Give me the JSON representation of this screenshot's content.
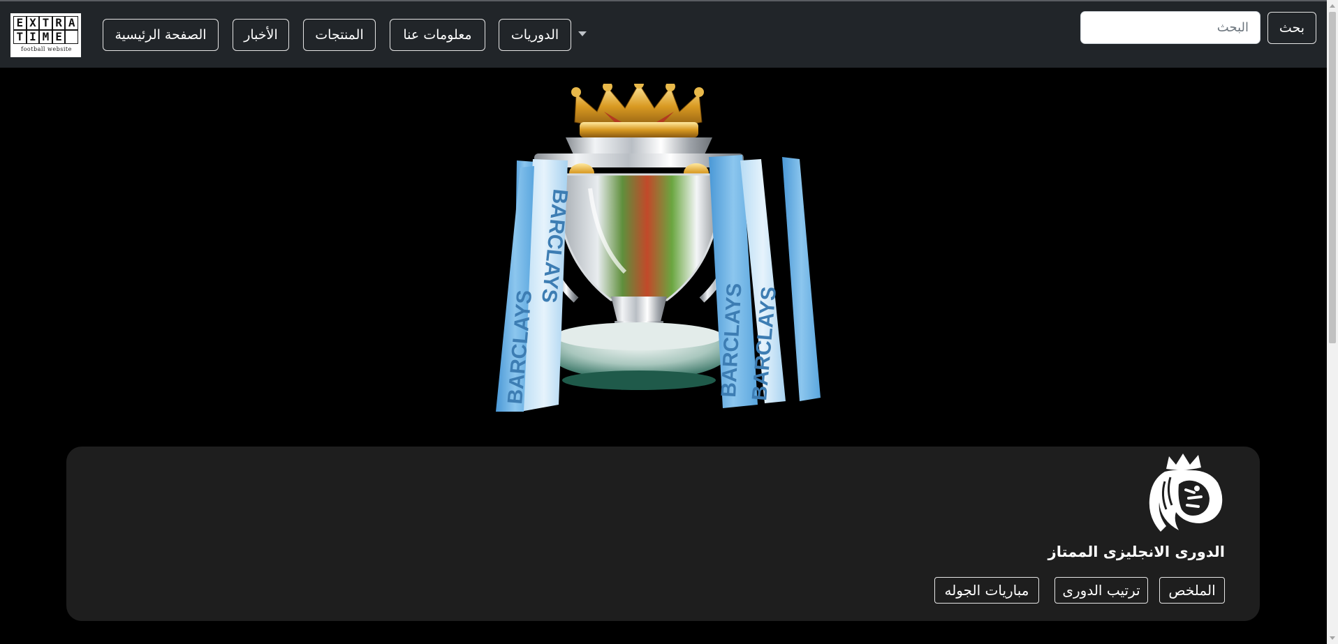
{
  "logo": {
    "letters_row1": [
      "E",
      "X",
      "T",
      "R",
      "A"
    ],
    "letters_row2": [
      "T",
      "I",
      "M",
      "E",
      ""
    ],
    "subtitle": "football website"
  },
  "nav": {
    "home": "الصفحة الرئيسية",
    "news": "الأخبار",
    "products": "المنتجات",
    "about": "معلومات عنا",
    "leagues": "الدوريات"
  },
  "search": {
    "placeholder": "البحث",
    "button": "بحث"
  },
  "hero": {
    "trophy_ribbon_text": "BARCLAYS"
  },
  "league_card": {
    "title": "الدورى الانجليزى الممتاز",
    "tabs": {
      "summary": "الملخص",
      "standings": "ترتيب الدورى",
      "matches": "مباريات الجوله"
    }
  },
  "colors": {
    "navbar": "#212529",
    "page_background": "#000000",
    "card_background": "#1e1e1e",
    "ribbon_blue": "#6fb6e6"
  }
}
